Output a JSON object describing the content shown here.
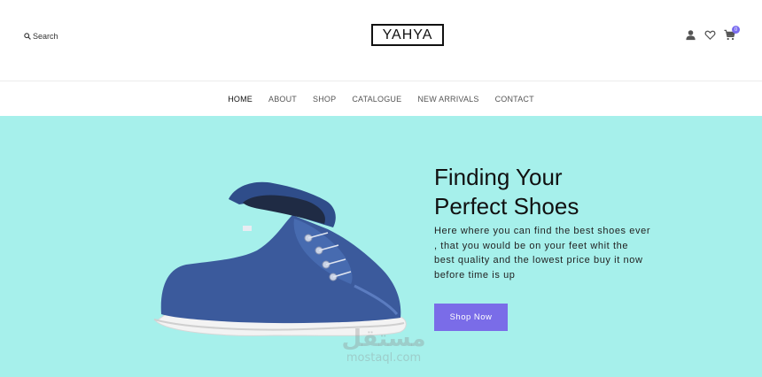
{
  "header": {
    "search_label": "Search",
    "logo_text": "YAHYA",
    "cart_count": "0"
  },
  "nav": {
    "items": [
      {
        "label": "HOME",
        "active": true
      },
      {
        "label": "ABOUT"
      },
      {
        "label": "SHOP"
      },
      {
        "label": "CATALOGUE"
      },
      {
        "label": "NEW ARRIVALS"
      },
      {
        "label": "CONTACT"
      }
    ]
  },
  "hero": {
    "title_line1": "Finding Your",
    "title_line2": "Perfect Shoes",
    "description": "Here where you can find the best shoes ever , that you would be on your feet whit the best quality and the lowest price buy it now before time is up",
    "button_label": "Shop Now"
  },
  "watermark": {
    "arabic": "مستقل",
    "latin": "mostaql.com"
  },
  "colors": {
    "hero_background": "#a6f0eb",
    "accent": "#7a6ce8",
    "text": "#111111"
  },
  "icons": [
    "search-icon",
    "user-icon",
    "heart-icon",
    "cart-icon"
  ]
}
